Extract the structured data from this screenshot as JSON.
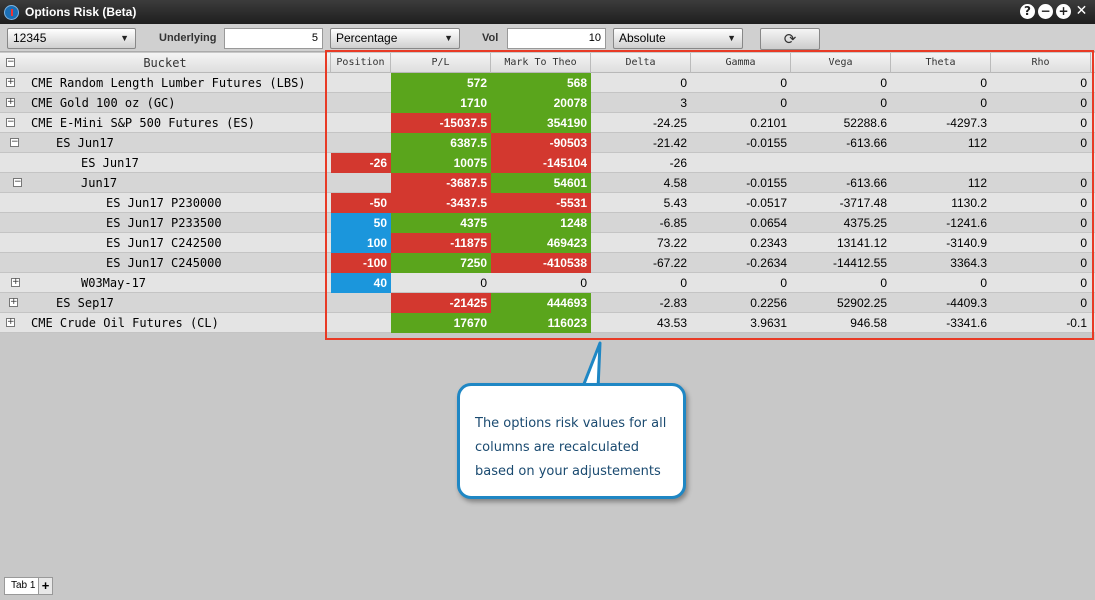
{
  "window": {
    "title": "Options Risk (Beta)"
  },
  "toolbar": {
    "account": "12345",
    "underlying_label": "Underlying",
    "underlying_value": "5",
    "underlying_mode": "Percentage",
    "vol_label": "Vol",
    "vol_value": "10",
    "vol_mode": "Absolute"
  },
  "columns": [
    "Bucket",
    "Position",
    "P/L",
    "Mark To Theo",
    "Delta",
    "Gamma",
    "Vega",
    "Theta",
    "Rho"
  ],
  "rows": [
    {
      "bucket": "CME Random Length Lumber Futures (LBS)",
      "toggle": "+",
      "position": "",
      "pl": "572",
      "mtt": "568",
      "delta": "0",
      "gamma": "0",
      "vega": "0",
      "theta": "0",
      "rho": "0"
    },
    {
      "bucket": "CME Gold 100 oz (GC)",
      "toggle": "+",
      "position": "",
      "pl": "1710",
      "mtt": "20078",
      "delta": "3",
      "gamma": "0",
      "vega": "0",
      "theta": "0",
      "rho": "0"
    },
    {
      "bucket": "CME E-Mini S&P 500 Futures (ES)",
      "toggle": "−",
      "position": "",
      "pl": "-15037.5",
      "mtt": "354190",
      "delta": "-24.25",
      "gamma": "0.2101",
      "vega": "52288.6",
      "theta": "-4297.3",
      "rho": "0"
    },
    {
      "bucket": "ES Jun17",
      "toggle": "−",
      "position": "",
      "pl": "6387.5",
      "mtt": "-90503",
      "delta": "-21.42",
      "gamma": "-0.0155",
      "vega": "-613.66",
      "theta": "112",
      "rho": "0"
    },
    {
      "bucket": "ES Jun17",
      "toggle": "",
      "position": "-26",
      "pl": "10075",
      "mtt": "-145104",
      "delta": "-26",
      "gamma": "",
      "vega": "",
      "theta": "",
      "rho": ""
    },
    {
      "bucket": "Jun17",
      "toggle": "−",
      "position": "",
      "pl": "-3687.5",
      "mtt": "54601",
      "delta": "4.58",
      "gamma": "-0.0155",
      "vega": "-613.66",
      "theta": "112",
      "rho": "0"
    },
    {
      "bucket": "ES Jun17 P230000",
      "toggle": "",
      "position": "-50",
      "pl": "-3437.5",
      "mtt": "-5531",
      "delta": "5.43",
      "gamma": "-0.0517",
      "vega": "-3717.48",
      "theta": "1130.2",
      "rho": "0"
    },
    {
      "bucket": "ES Jun17 P233500",
      "toggle": "",
      "position": "50",
      "pl": "4375",
      "mtt": "1248",
      "delta": "-6.85",
      "gamma": "0.0654",
      "vega": "4375.25",
      "theta": "-1241.6",
      "rho": "0"
    },
    {
      "bucket": "ES Jun17 C242500",
      "toggle": "",
      "position": "100",
      "pl": "-11875",
      "mtt": "469423",
      "delta": "73.22",
      "gamma": "0.2343",
      "vega": "13141.12",
      "theta": "-3140.9",
      "rho": "0"
    },
    {
      "bucket": "ES Jun17 C245000",
      "toggle": "",
      "position": "-100",
      "pl": "7250",
      "mtt": "-410538",
      "delta": "-67.22",
      "gamma": "-0.2634",
      "vega": "-14412.55",
      "theta": "3364.3",
      "rho": "0"
    },
    {
      "bucket": "W03May-17",
      "toggle": "+",
      "position": "40",
      "pl": "0",
      "mtt": "0",
      "delta": "0",
      "gamma": "0",
      "vega": "0",
      "theta": "0",
      "rho": "0"
    },
    {
      "bucket": "ES Sep17",
      "toggle": "+",
      "position": "",
      "pl": "-21425",
      "mtt": "444693",
      "delta": "-2.83",
      "gamma": "0.2256",
      "vega": "52902.25",
      "theta": "-4409.3",
      "rho": "0"
    },
    {
      "bucket": "CME Crude Oil Futures (CL)",
      "toggle": "+",
      "position": "",
      "pl": "17670",
      "mtt": "116023",
      "delta": "43.53",
      "gamma": "3.9631",
      "vega": "946.58",
      "theta": "-3341.6",
      "rho": "-0.1"
    }
  ],
  "callout": {
    "text": "The options risk values for all columns are recalculated based on your adjustements"
  },
  "tabs": [
    {
      "label": "Tab 1"
    }
  ],
  "colors": {
    "positive": "#5aa51c",
    "negative": "#d3382f",
    "long_position": "#1b96dc",
    "short_position": "#d3382f",
    "highlight_border": "#e83a25",
    "callout_border": "#1f87c4"
  }
}
